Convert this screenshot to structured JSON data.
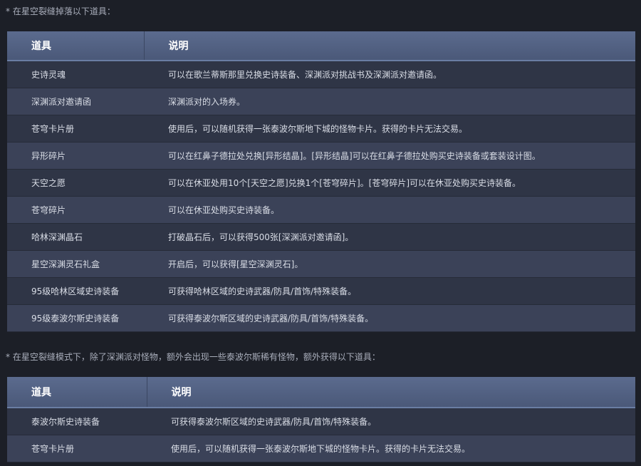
{
  "section1": {
    "note": "* 在星空裂缝掉落以下道具：",
    "header": {
      "col1": "道具",
      "col2": "说明"
    },
    "rows": [
      {
        "item": "史诗灵魂",
        "desc": "可以在歌兰蒂斯那里兑换史诗装备、深渊派对挑战书及深渊派对邀请函。"
      },
      {
        "item": "深渊派对邀请函",
        "desc": "深渊派对的入场券。"
      },
      {
        "item": "苍穹卡片册",
        "desc": "使用后，可以随机获得一张泰波尔斯地下城的怪物卡片。获得的卡片无法交易。"
      },
      {
        "item": "异形碎片",
        "desc": "可以在红鼻子德拉处兑换[异形结晶]。[异形结晶]可以在红鼻子德拉处购买史诗装备或套装设计图。"
      },
      {
        "item": "天空之愿",
        "desc": "可以在休亚处用10个[天空之愿]兑换1个[苍穹碎片]。[苍穹碎片]可以在休亚处购买史诗装备。"
      },
      {
        "item": "苍穹碎片",
        "desc": "可以在休亚处购买史诗装备。"
      },
      {
        "item": "哈林深渊晶石",
        "desc": "打破晶石后，可以获得500张[深渊派对邀请函]。"
      },
      {
        "item": "星空深渊灵石礼盒",
        "desc": "开启后，可以获得[星空深渊灵石]。"
      },
      {
        "item": "95级哈林区域史诗装备",
        "desc": "可获得哈林区域的史诗武器/防具/首饰/特殊装备。"
      },
      {
        "item": "95级泰波尔斯史诗装备",
        "desc": "可获得泰波尔斯区域的史诗武器/防具/首饰/特殊装备。"
      }
    ]
  },
  "section2": {
    "note": "* 在星空裂缝模式下，除了深渊派对怪物，额外会出现一些泰波尔斯稀有怪物，额外获得以下道具：",
    "header": {
      "col1": "道具",
      "col2": "说明"
    },
    "rows": [
      {
        "item": "泰波尔斯史诗装备",
        "desc": "可获得泰波尔斯区域的史诗武器/防具/首饰/特殊装备。"
      },
      {
        "item": "苍穹卡片册",
        "desc": "使用后，可以随机获得一张泰波尔斯地下城的怪物卡片。获得的卡片无法交易。"
      }
    ]
  }
}
